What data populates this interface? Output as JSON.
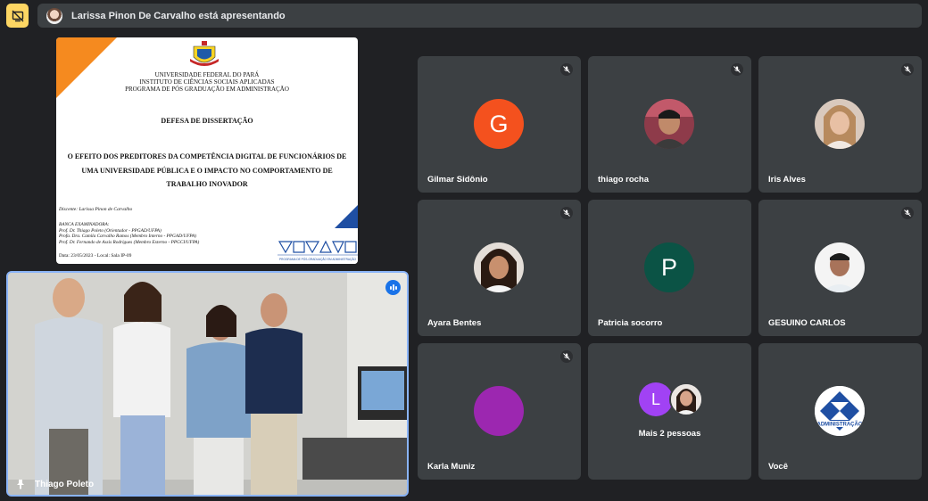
{
  "topbar": {
    "presenting_text": "Larissa Pinon De Carvalho está apresentando"
  },
  "slide": {
    "institution_lines": [
      "UNIVERSIDADE FEDERAL DO PARÁ",
      "INSTITUTO DE CIÊNCIAS SOCIAIS APLICADAS",
      "PROGRAMA DE PÓS GRADUAÇÃO EM ADMINISTRAÇÃO"
    ],
    "heading": "DEFESA DE DISSERTAÇÃO",
    "thesis_title_lines": [
      "O EFEITO DOS PREDITORES DA COMPETÊNCIA DIGITAL DE FUNCIONÁRIOS DE",
      "UMA UNIVERSIDADE PÚBLICA E O IMPACTO NO COMPORTAMENTO DE",
      "TRABALHO INOVADOR"
    ],
    "discente": "Discente: Larissa Pinon de Carvalho",
    "banca_title": "BANCA EXAMINADORA:",
    "banca_members": [
      "Prof. Dr. Thiago Poleto (Orientador - PPGAD/UFPA)",
      "Profa. Dra. Camila Carvalho Ramos (Membro Interno - PPGAD/UFPA)",
      "Prof. Dr. Fernando de Assis Rodrigues (Membro Externo - PPGCI/UFPA)"
    ],
    "date_line": "Data: 23/05/2023 - Local: Sala IP-09",
    "logo_caption": "PROGRAMA DE PÓS-GRADUAÇÃO EM ADMINISTRAÇÃO"
  },
  "self_view": {
    "name": "Thiago Poleto"
  },
  "participants": [
    {
      "name": "Gilmar Sidônio",
      "initial": "G",
      "color": "#f4511e",
      "muted": true
    },
    {
      "name": "thiago rocha",
      "initial": "",
      "color": "#7a6a5a",
      "muted": true
    },
    {
      "name": "Iris Alves",
      "initial": "",
      "color": "#c9a48a",
      "muted": true
    },
    {
      "name": "Ayara Bentes",
      "initial": "",
      "color": "#8b5e4a",
      "muted": true
    },
    {
      "name": "Patricia socorro",
      "initial": "P",
      "color": "#0b5345",
      "muted": false
    },
    {
      "name": "GESUINO CARLOS",
      "initial": "",
      "color": "#e0e0e0",
      "muted": true
    },
    {
      "name": "Karla Muniz",
      "initial": "",
      "color": "#9c27b0",
      "muted": true
    },
    {
      "name": "",
      "initial": "L",
      "color": "#a142f4",
      "muted": false
    },
    {
      "name": "Você",
      "initial": "",
      "color": "#ffffff",
      "muted": false
    }
  ],
  "more_people": {
    "label": "Mais 2 pessoas",
    "initial": "L"
  },
  "self_avatar": {
    "logo_text": "ADMINISTRAÇÃO"
  }
}
